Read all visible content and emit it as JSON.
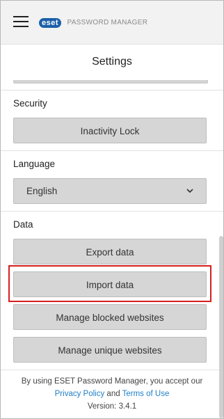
{
  "header": {
    "logo_brand": "eset",
    "logo_product": "PASSWORD MANAGER",
    "menu_icon": "hamburger-menu-icon"
  },
  "page": {
    "title": "Settings"
  },
  "sections": {
    "security": {
      "label": "Security",
      "button": "Inactivity Lock"
    },
    "language": {
      "label": "Language",
      "selected": "English",
      "icon": "chevron-down-icon"
    },
    "data": {
      "label": "Data",
      "buttons": [
        "Export data",
        "Import data",
        "Manage blocked websites",
        "Manage unique websites"
      ]
    }
  },
  "footer": {
    "text_prefix": "By using ESET Password Manager, you accept our",
    "privacy_link": "Privacy Policy",
    "and": "and",
    "terms_link": "Terms of Use",
    "version": "Version: 3.4.1"
  },
  "colors": {
    "brand": "#1c5fa9",
    "highlight": "#d71e1e",
    "link": "#1e7fc7"
  }
}
